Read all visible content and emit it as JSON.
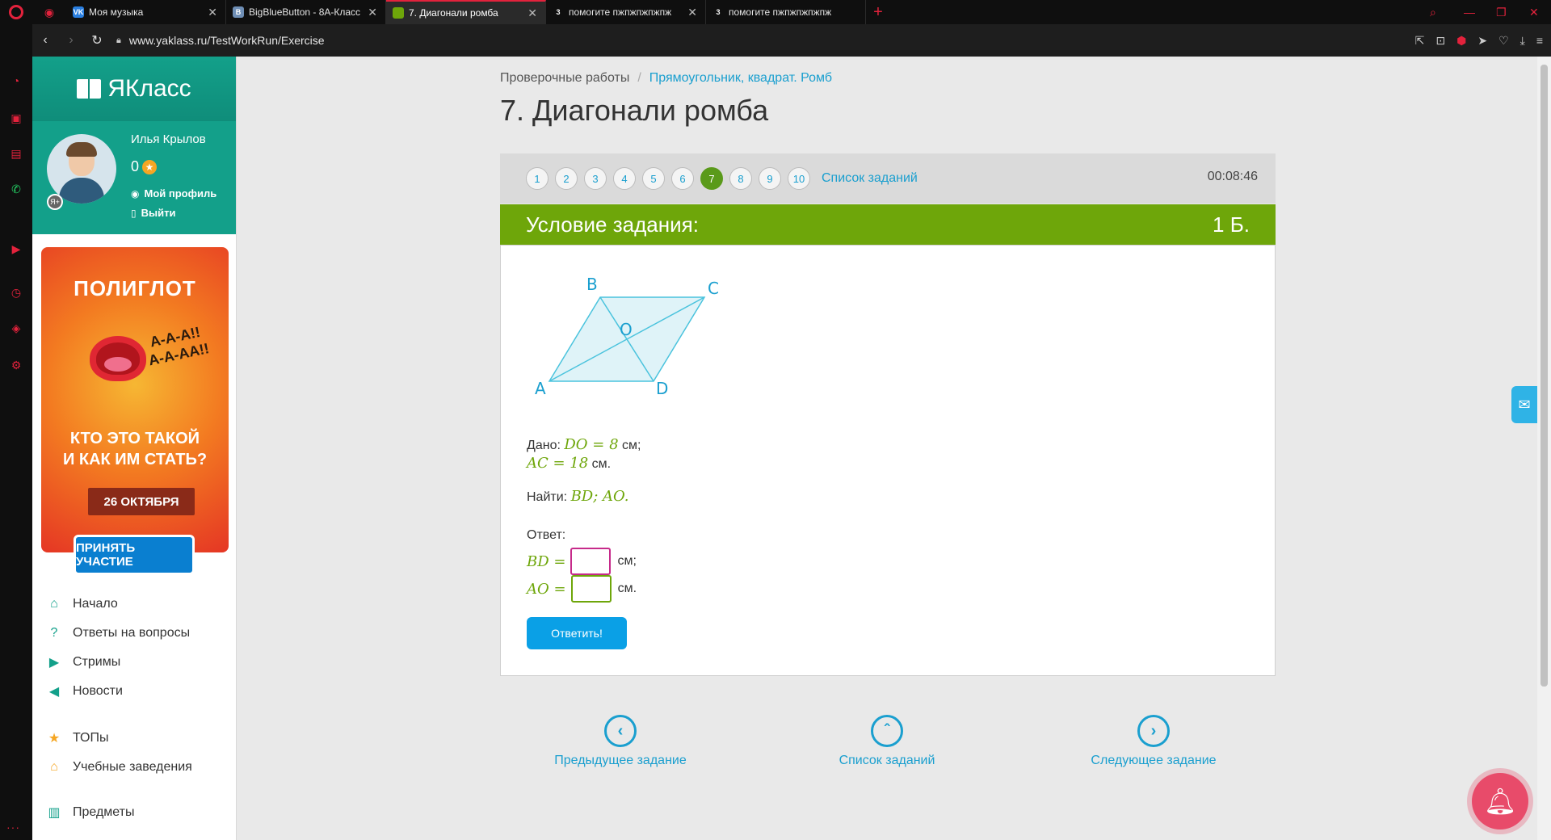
{
  "browser": {
    "tabs": [
      {
        "title": "Моя музыка",
        "favicon": "VK",
        "color": "#2a7fe0"
      },
      {
        "title": "BigBlueButton - 8А-Класс",
        "favicon": "B",
        "color": "#6f8fb6"
      },
      {
        "title": "7. Диагонали ромба",
        "favicon": "",
        "color": "#6ea60a"
      },
      {
        "title": "помогите пжпжпжпжпж",
        "favicon": "3",
        "color": "#0f0f0f"
      },
      {
        "title": "помогите пжпжпжпжпж",
        "favicon": "3",
        "color": "#0f0f0f"
      }
    ],
    "url": "www.yaklass.ru/TestWorkRun/Exercise"
  },
  "site": {
    "logo": "ЯКласс",
    "user": {
      "name": "Илья Крылов",
      "points": "0",
      "profile_link": "Мой профиль",
      "logout_link": "Выйти"
    },
    "ad": {
      "title": "ПОЛИГЛОТ",
      "shout": "А-А-А!!\nА-А-АА!!",
      "question": "КТО ЭТО ТАКОЙ\nИ КАК ИМ СТАТЬ?",
      "date": "26 ОКТЯБРЯ",
      "button": "ПРИНЯТЬ УЧАСТИЕ"
    },
    "nav": [
      {
        "label": "Начало",
        "icon": "home-icon"
      },
      {
        "label": "Ответы на вопросы",
        "icon": "question-icon"
      },
      {
        "label": "Стримы",
        "icon": "play-icon"
      },
      {
        "label": "Новости",
        "icon": "news-icon"
      },
      {
        "label": "ТОПы",
        "icon": "star-icon"
      },
      {
        "label": "Учебные заведения",
        "icon": "building-icon"
      },
      {
        "label": "Предметы",
        "icon": "book-icon"
      }
    ]
  },
  "breadcrumb": {
    "root": "Проверочные работы",
    "sep": "/",
    "current": "Прямоугольник, квадрат. Ромб"
  },
  "page_title": "7. Диагонали ромба",
  "task_nav": {
    "numbers": [
      "1",
      "2",
      "3",
      "4",
      "5",
      "6",
      "7",
      "8",
      "9",
      "10"
    ],
    "active": 7,
    "list_link": "Список заданий",
    "timer": "00:08:46"
  },
  "condition": {
    "header": "Условие задания:",
    "points": "1 Б.",
    "figure_labels": {
      "A": "A",
      "B": "B",
      "C": "C",
      "D": "D",
      "O": "O"
    },
    "given_prefix": "Дано:",
    "given_1": "DO = 8",
    "given_1_unit": "см;",
    "given_2": "AC = 18",
    "given_2_unit": "см.",
    "find_prefix": "Найти:",
    "find_value": "BD; AO.",
    "answer_label": "Ответ:",
    "ans_1_label": "BD =",
    "ans_1_unit": "см;",
    "ans_2_label": "AO =",
    "ans_2_unit": "см.",
    "submit": "Ответить!"
  },
  "bottom_nav": {
    "prev": "Предыдущее задание",
    "list": "Список заданий",
    "next": "Следующее задание"
  }
}
